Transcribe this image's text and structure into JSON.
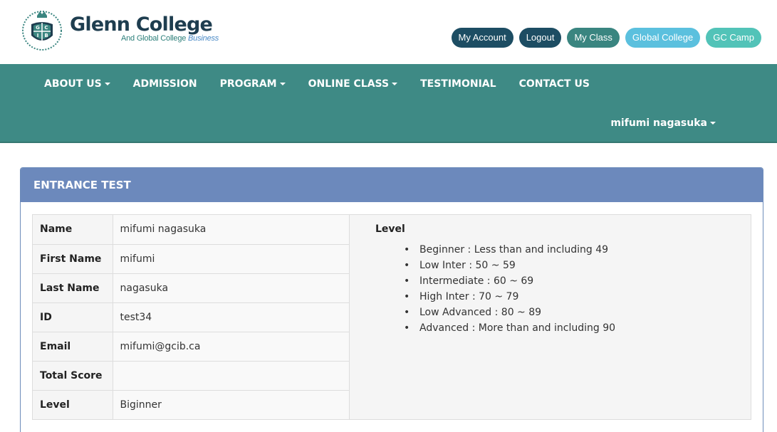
{
  "brand": {
    "title": "Glenn College",
    "subtitle_main": "And Global College",
    "subtitle_accent": "Business",
    "crest_letters": [
      "G",
      "C",
      "I",
      "B"
    ]
  },
  "top_links": [
    {
      "label": "My Account",
      "style": "dark"
    },
    {
      "label": "Logout",
      "style": "dark"
    },
    {
      "label": "My Class",
      "style": "teal"
    },
    {
      "label": "Global College",
      "style": "light"
    },
    {
      "label": "GC Camp",
      "style": "mint"
    }
  ],
  "nav": {
    "items": [
      {
        "label": "ABOUT US",
        "dropdown": true
      },
      {
        "label": "ADMISSION",
        "dropdown": false
      },
      {
        "label": "PROGRAM",
        "dropdown": true
      },
      {
        "label": "ONLINE CLASS",
        "dropdown": true
      },
      {
        "label": "TESTIMONIAL",
        "dropdown": false
      },
      {
        "label": "CONTACT US",
        "dropdown": false
      }
    ],
    "user": "mifumi nagasuka"
  },
  "panel": {
    "title": "ENTRANCE TEST",
    "rows": [
      {
        "key": "Name",
        "value": "mifumi nagasuka"
      },
      {
        "key": "First Name",
        "value": "mifumi"
      },
      {
        "key": "Last Name",
        "value": "nagasuka"
      },
      {
        "key": "ID",
        "value": "test34"
      },
      {
        "key": "Email",
        "value": "mifumi@gcib.ca"
      },
      {
        "key": "Total Score",
        "value": ""
      },
      {
        "key": "Level",
        "value": "Biginner"
      }
    ],
    "level_title": "Level",
    "levels": [
      "Beginner : Less than and including 49",
      "Low Inter : 50 ~ 59",
      "Intermediate : 60 ~ 69",
      "High Inter : 70 ~ 79",
      "Low Advanced : 80 ~ 89",
      "Advanced : More than and including 90"
    ]
  },
  "colors": {
    "nav_bg": "#3e8a85",
    "panel_header": "#6c89bc",
    "brand_dark": "#1e3d4f",
    "pill_dark": "#1d4d63",
    "pill_teal": "#3a8580",
    "pill_light": "#5bc0de",
    "pill_mint": "#52c3b8"
  }
}
